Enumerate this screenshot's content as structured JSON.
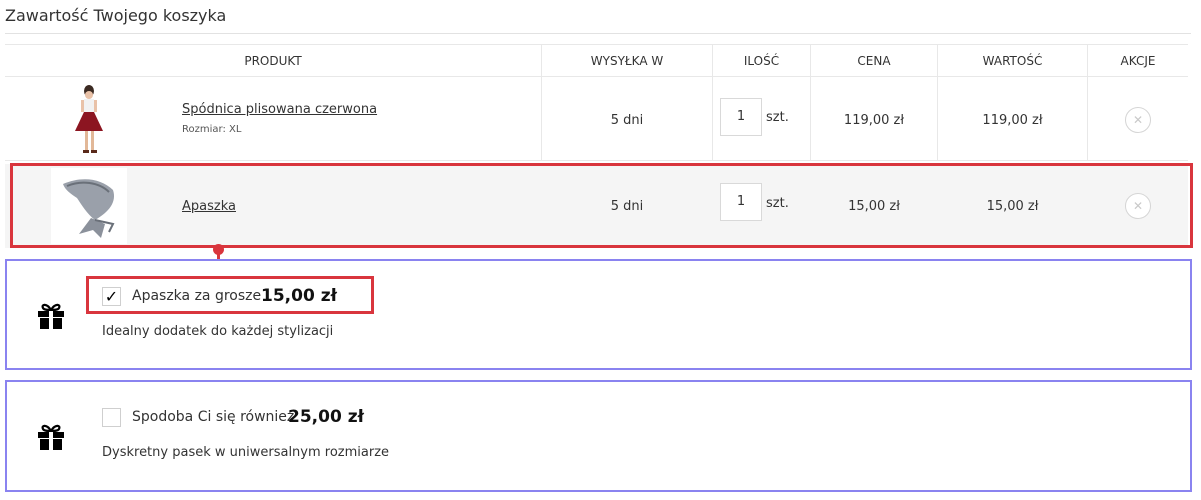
{
  "cart": {
    "title": "Zawartość Twojego koszyka",
    "columns": {
      "product": "PRODUKT",
      "shipping": "WYSYŁKA W",
      "quantity": "ILOŚĆ",
      "price": "CENA",
      "value": "WARTOŚĆ",
      "actions": "AKCJE"
    },
    "items": [
      {
        "name": "Spódnica plisowana czerwona",
        "size": "Rozmiar: XL",
        "shipping": "5 dni",
        "qty": "1",
        "unit": "szt.",
        "price": "119,00 zł",
        "value": "119,00 zł",
        "remove_icon": "close-icon"
      },
      {
        "name": "Apaszka",
        "shipping": "5 dni",
        "qty": "1",
        "unit": "szt.",
        "price": "15,00 zł",
        "value": "15,00 zł",
        "remove_icon": "close-icon"
      }
    ]
  },
  "offers": [
    {
      "checked": true,
      "label": "Apaszka za grosze",
      "price": "15,00 zł",
      "description": "Idealny dodatek do każdej stylizacji",
      "icon": "gift-icon"
    },
    {
      "checked": false,
      "label": "Spodoba Ci się również",
      "price": "25,00 zł",
      "description": "Dyskretny pasek w uniwersalnym rozmiarze",
      "icon": "gift-icon"
    }
  ],
  "colors": {
    "highlight": "#d9353d",
    "offer_border": "#8a83f0",
    "selected_row": "#f5f5f5"
  }
}
